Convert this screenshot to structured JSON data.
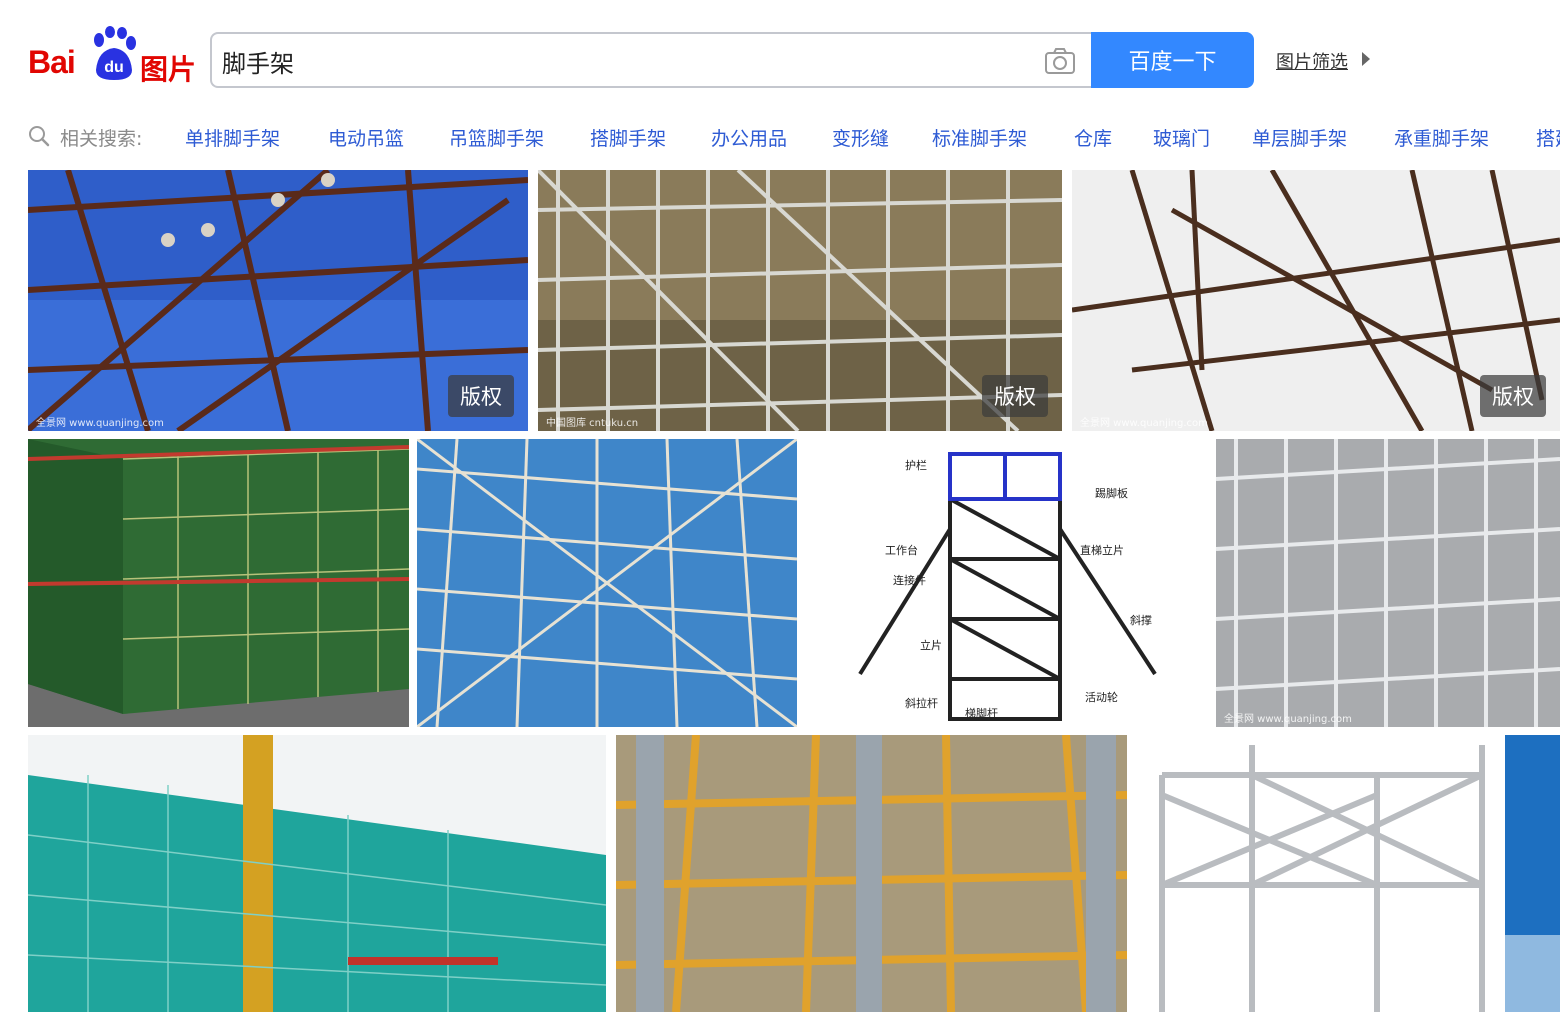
{
  "logo": {
    "bai": "Bai",
    "du": "du",
    "product": "图片"
  },
  "search": {
    "query": "脚手架",
    "button_label": "百度一下",
    "filter_label": "图片筛选"
  },
  "related": {
    "label": "相关搜索:",
    "terms": [
      "单排脚手架",
      "电动吊篮",
      "吊篮脚手架",
      "搭脚手架",
      "办公用品",
      "变形缝",
      "标准脚手架",
      "仓库",
      "玻璃门",
      "单层脚手架",
      "承重脚手架",
      "搭建"
    ]
  },
  "images": [
    {
      "badge": "版权",
      "watermark": "全景网 www.quanjing.com"
    },
    {
      "badge": "版权",
      "watermark": "中国图库 cntuku.cn"
    },
    {
      "badge": "版权",
      "watermark": "全景网 www.quanjing.com"
    },
    {
      "badge": "",
      "watermark": ""
    },
    {
      "badge": "",
      "watermark": ""
    },
    {
      "badge": "",
      "watermark": "",
      "labels": [
        "护栏",
        "踢脚板",
        "工作台",
        "直梯立片",
        "连接件",
        "斜撑",
        "立片",
        "活动轮",
        "斜拉杆",
        "梯脚杆"
      ]
    },
    {
      "badge": "",
      "watermark": "全景网 www.quanjing.com"
    },
    {
      "badge": "",
      "watermark": ""
    },
    {
      "badge": "",
      "watermark": ""
    },
    {
      "badge": "",
      "watermark": ""
    },
    {
      "badge": "",
      "watermark": ""
    }
  ]
}
